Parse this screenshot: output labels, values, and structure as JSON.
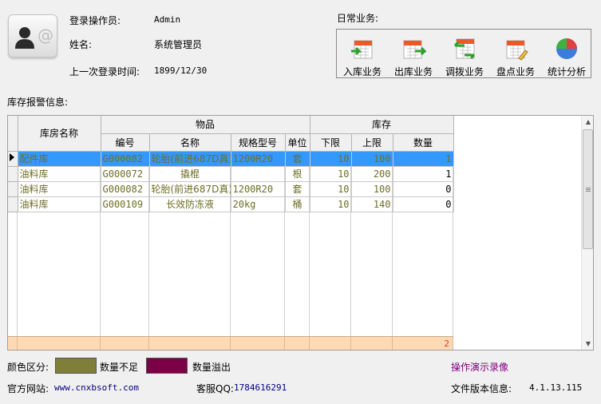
{
  "user": {
    "login_label": "登录操作员:",
    "login_value": "Admin",
    "name_label": "姓名:",
    "name_value": "系统管理员",
    "last_login_label": "上一次登录时间:",
    "last_login_value": "1899/12/30"
  },
  "business": {
    "title": "日常业务:",
    "buttons": [
      {
        "label": "入库业务",
        "icon": "stock-in-icon"
      },
      {
        "label": "出库业务",
        "icon": "stock-out-icon"
      },
      {
        "label": "调拨业务",
        "icon": "transfer-icon"
      },
      {
        "label": "盘点业务",
        "icon": "inventory-check-icon"
      },
      {
        "label": "统计分析",
        "icon": "pie-chart-icon"
      }
    ]
  },
  "alarm": {
    "title": "库存报警信息:",
    "headers": {
      "warehouse": "库房名称",
      "goods_group": "物品",
      "stock_group": "库存",
      "code": "编号",
      "name": "名称",
      "spec": "规格型号",
      "unit": "单位",
      "lower": "下限",
      "upper": "上限",
      "qty": "数量"
    },
    "rows": [
      {
        "warehouse": "配件库",
        "code": "G000082",
        "name": "轮胎(前进687D真)",
        "spec": "1200R20",
        "unit": "套",
        "lower": "10",
        "upper": "100",
        "qty": "1"
      },
      {
        "warehouse": "油料库",
        "code": "G000072",
        "name": "撬棍",
        "spec": "",
        "unit": "根",
        "lower": "10",
        "upper": "200",
        "qty": "1"
      },
      {
        "warehouse": "油料库",
        "code": "G000082",
        "name": "轮胎(前进687D真)",
        "spec": "1200R20",
        "unit": "套",
        "lower": "10",
        "upper": "100",
        "qty": "0"
      },
      {
        "warehouse": "油料库",
        "code": "G000109",
        "name": "长效防冻液",
        "spec": "20kg",
        "unit": "桶",
        "lower": "10",
        "upper": "140",
        "qty": "0"
      }
    ],
    "total_qty": "2"
  },
  "legend": {
    "label": "颜色区分:",
    "shortage_color": "#7f7f3a",
    "shortage_label": "数量不足",
    "overflow_color": "#7c0046",
    "overflow_label": "数量溢出"
  },
  "footer": {
    "demo_link": "操作演示录像",
    "website_label": "官方网站:",
    "website_value": "www.cnxbsoft.com",
    "qq_label": "客服QQ:",
    "qq_value": "1784616291",
    "version_label": "文件版本信息:",
    "version_value": "4.1.13.115"
  }
}
